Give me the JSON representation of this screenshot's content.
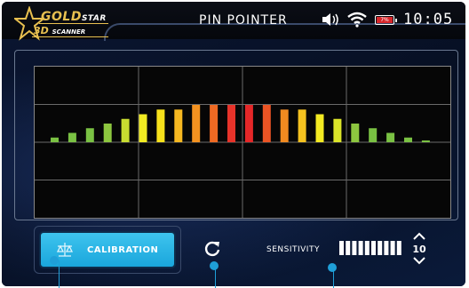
{
  "header": {
    "logo": {
      "line1": "GOLD",
      "line1_small": "STAR",
      "line2": "3D",
      "line2_small": "SCANNER"
    },
    "title": "PIN POINTER",
    "battery": "7%",
    "time": "10:05"
  },
  "icons": {
    "speaker": "speaker-icon",
    "wifi": "wifi-icon",
    "battery": "battery-icon",
    "calibration": "calibration-icon",
    "refresh": "refresh-icon",
    "sens_up": "arrow-up-icon",
    "sens_down": "arrow-down-icon"
  },
  "chart_data": {
    "type": "bar",
    "values": [
      1,
      2,
      3,
      4,
      5,
      6,
      7,
      7,
      8,
      8,
      8,
      8,
      8,
      7,
      7,
      6,
      5,
      4,
      3,
      2,
      1,
      0.3
    ],
    "colors": [
      "#7ac143",
      "#7ac143",
      "#7ac143",
      "#8dc63f",
      "#c8dc30",
      "#f2ec22",
      "#f7e11b",
      "#f6b821",
      "#f39220",
      "#ef6a23",
      "#e7332a",
      "#e52728",
      "#ec5424",
      "#f18a20",
      "#f5c21f",
      "#f3ea22",
      "#dbe429",
      "#8dc63f",
      "#7ac143",
      "#7ac143",
      "#7ac143",
      "#7ac143"
    ]
  },
  "controls": {
    "calibration_label": "CALIBRATION",
    "sensitivity_label": "SENSITIVITY",
    "sensitivity_value": "10",
    "sensitivity_level": 10,
    "sensitivity_max": 10
  },
  "colors": {
    "accent": "#1fa6dc",
    "gold": "#e8c050",
    "background": "#05070c"
  }
}
